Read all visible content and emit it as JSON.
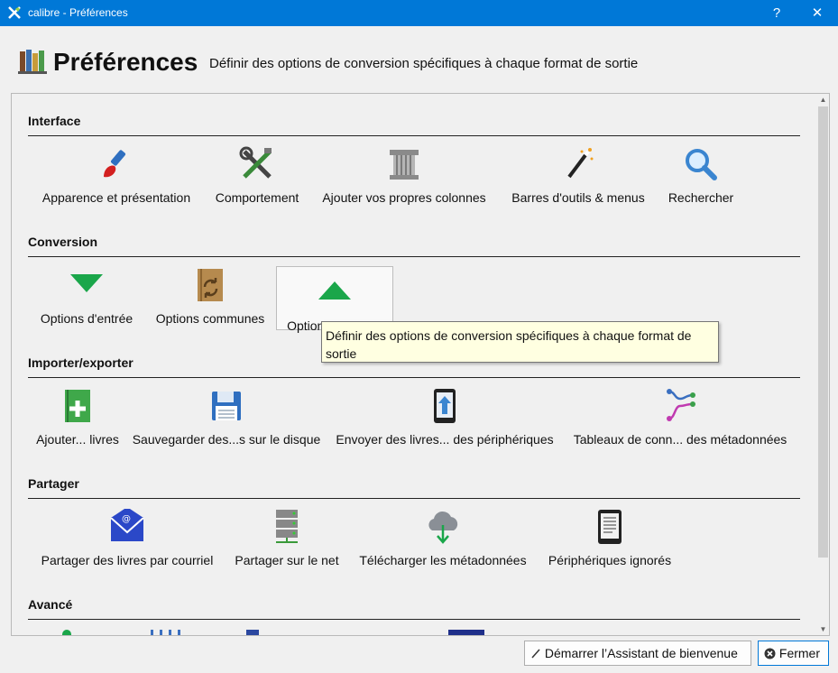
{
  "window": {
    "title": "calibre - Préférences",
    "help_label": "?",
    "close_label": "✕"
  },
  "header": {
    "title": "Préférences",
    "description": "Définir des options de conversion spécifiques à chaque format de sortie"
  },
  "sections": {
    "interface": {
      "title": "Interface",
      "items": [
        {
          "label": "Apparence et présentation",
          "icon": "paintbrush-icon"
        },
        {
          "label": "Comportement",
          "icon": "tools-icon"
        },
        {
          "label": "Ajouter vos propres colonnes",
          "icon": "column-icon"
        },
        {
          "label": "Barres d'outils & menus",
          "icon": "magic-wand-icon"
        },
        {
          "label": "Rechercher",
          "icon": "search-icon"
        }
      ]
    },
    "conversion": {
      "title": "Conversion",
      "items": [
        {
          "label": "Options d'entrée",
          "icon": "arrow-down-icon"
        },
        {
          "label": "Options communes",
          "icon": "book-convert-icon"
        },
        {
          "label": "Options de sortie",
          "icon": "arrow-up-icon"
        }
      ]
    },
    "import_export": {
      "title": "Importer/exporter",
      "items": [
        {
          "label": "Ajouter... livres",
          "icon": "add-book-icon"
        },
        {
          "label": "Sauvegarder des...s sur le disque",
          "icon": "save-icon"
        },
        {
          "label": "Envoyer des livres... des périphériques",
          "icon": "send-device-icon"
        },
        {
          "label": "Tableaux de conn... des métadonnées",
          "icon": "plugboard-icon"
        }
      ]
    },
    "sharing": {
      "title": "Partager",
      "items": [
        {
          "label": "Partager des livres par courriel",
          "icon": "email-icon"
        },
        {
          "label": "Partager sur le net",
          "icon": "server-icon"
        },
        {
          "label": "Télécharger les métadonnées",
          "icon": "cloud-download-icon"
        },
        {
          "label": "Périphériques ignorés",
          "icon": "ereader-icon"
        }
      ]
    },
    "advanced": {
      "title": "Avancé"
    }
  },
  "tooltip": {
    "text": "Définir des options de conversion spécifiques à chaque format de sortie"
  },
  "footer": {
    "wizard_label": "Démarrer l’Assistant de bienvenue",
    "close_label": "Fermer"
  },
  "colors": {
    "titlebar": "#0078d7",
    "tooltip_bg": "#ffffe1",
    "green": "#1aa64a"
  }
}
